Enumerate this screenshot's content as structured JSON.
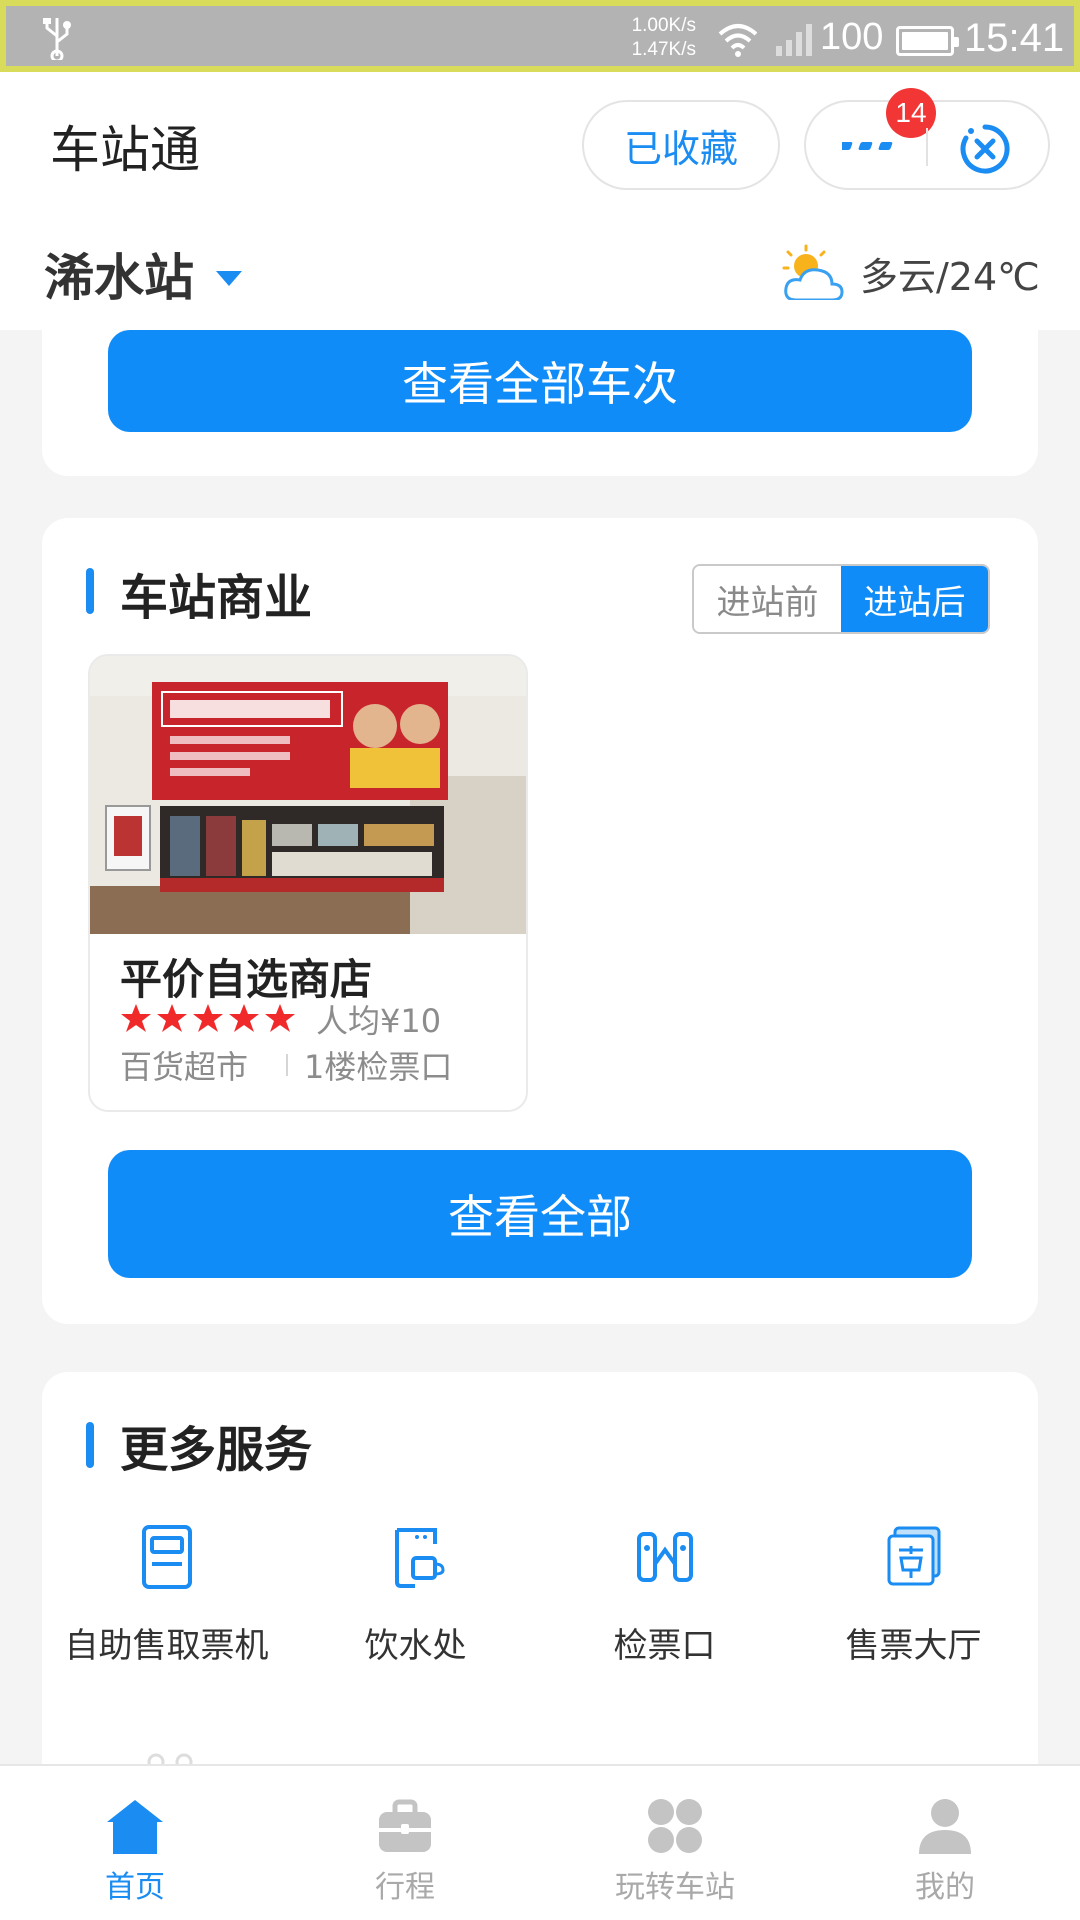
{
  "status_bar": {
    "speed_up": "1.00K/s",
    "speed_down": "1.47K/s",
    "battery": "100",
    "time": "15:41"
  },
  "header": {
    "app_title": "车站通",
    "favorite_label": "已收藏",
    "notification_count": "14",
    "station_name": "浠水站",
    "weather": "多云/24℃"
  },
  "trains_card": {
    "view_all_trains_label": "查看全部车次"
  },
  "business": {
    "title": "车站商业",
    "segments": [
      "进站前",
      "进站后"
    ],
    "active_segment": "进站后",
    "shop": {
      "name": "平价自选商店",
      "rating": 5,
      "price": "人均¥10",
      "category": "百货超市",
      "location": "1楼检票口"
    },
    "view_all_label": "查看全部"
  },
  "more_services": {
    "title": "更多服务",
    "items": [
      {
        "label": "自助售取票机",
        "icon": "ticket-machine-icon"
      },
      {
        "label": "饮水处",
        "icon": "water-dispenser-icon"
      },
      {
        "label": "检票口",
        "icon": "ticket-gate-icon"
      },
      {
        "label": "售票大厅",
        "icon": "ticket-hall-icon"
      }
    ]
  },
  "bottom_nav": [
    {
      "label": "首页",
      "icon": "home-icon",
      "active": true
    },
    {
      "label": "行程",
      "icon": "briefcase-icon",
      "active": false
    },
    {
      "label": "玩转车站",
      "icon": "grid-icon",
      "active": false
    },
    {
      "label": "我的",
      "icon": "person-icon",
      "active": false
    }
  ],
  "colors": {
    "primary": "#0f8cf8",
    "badge": "#f23636",
    "star": "#f02a2a"
  }
}
